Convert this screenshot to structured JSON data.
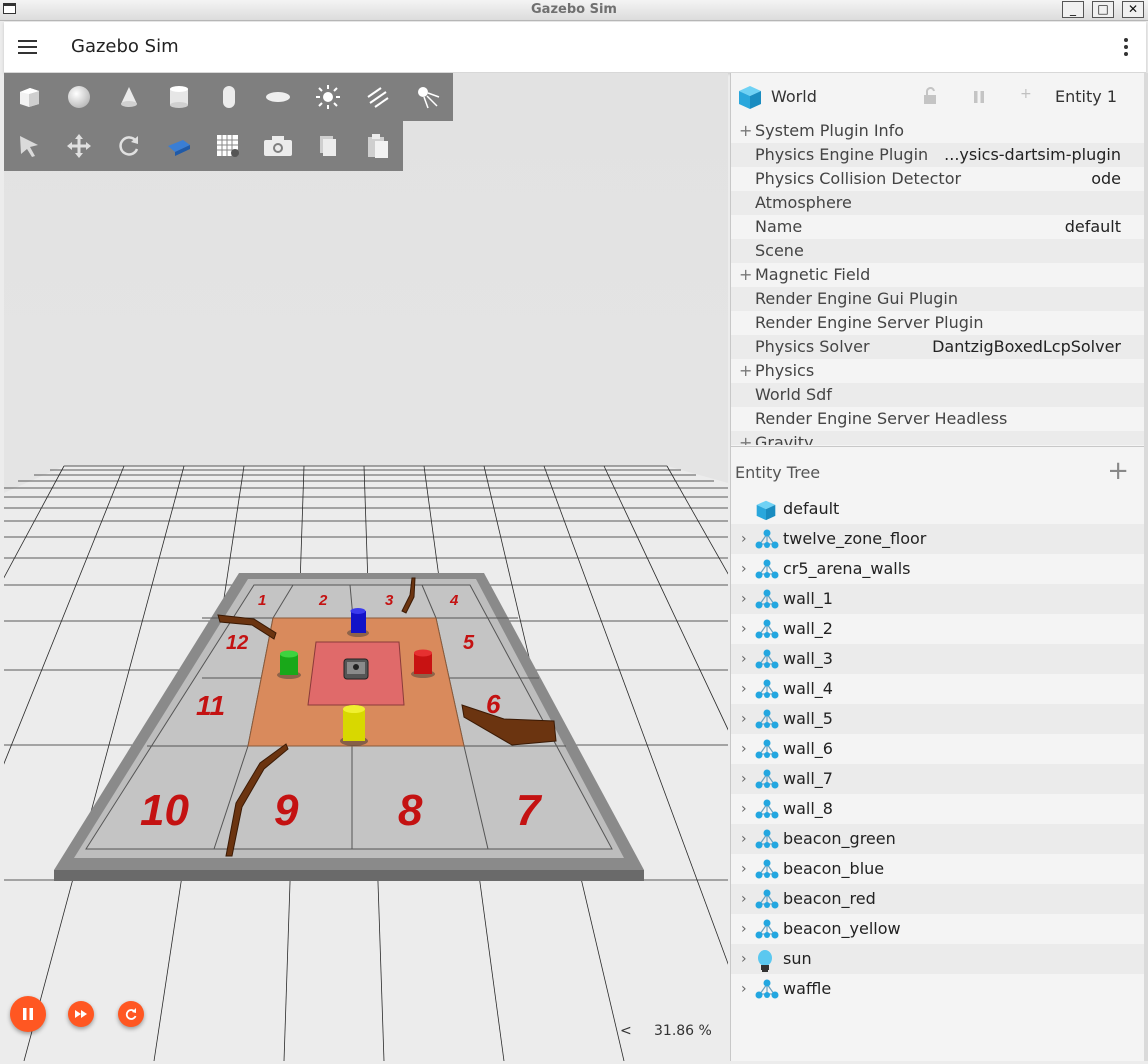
{
  "window": {
    "title": "Gazebo Sim",
    "buttons": [
      "_",
      "□",
      "✕"
    ]
  },
  "appbar": {
    "title": "Gazebo Sim"
  },
  "toolbar": {
    "shapes": [
      "box-icon",
      "sphere-icon",
      "cone-icon",
      "cylinder-icon",
      "capsule-icon",
      "ellipsoid-icon",
      "point-light-icon",
      "directional-light-icon",
      "spot-light-icon"
    ],
    "transform": [
      "select-arrow-icon",
      "translate-icon",
      "rotate-icon",
      "view-angle-icon",
      "grid-icon",
      "screenshot-camera-icon",
      "copy-icon",
      "paste-icon"
    ]
  },
  "scene": {
    "zone_labels": [
      "1",
      "2",
      "3",
      "4",
      "5",
      "6",
      "7",
      "8",
      "9",
      "10",
      "11",
      "12"
    ],
    "colors": {
      "zone_text": "#c41212",
      "floor_orange": "#d98a5c",
      "center_red": "#e06a6a",
      "wall": "#808080",
      "brown_wall": "#6b3410",
      "beacon_green": "#19a819",
      "beacon_blue": "#1212c8",
      "beacon_red": "#c81212",
      "beacon_yellow": "#d8d800"
    }
  },
  "playback": {
    "pause_icon": "pause-icon",
    "step_icon": "fast-forward-icon",
    "reset_icon": "reset-icon",
    "accent": "#ff5722"
  },
  "rtf": {
    "arrow": "<",
    "value": "31.86 %"
  },
  "component_inspector": {
    "world_label": "World",
    "entity_label": "Entity 1",
    "properties": [
      {
        "expand": "+",
        "key": "System Plugin Info",
        "value": ""
      },
      {
        "expand": "",
        "key": "Physics Engine Plugin",
        "value": "...ysics-dartsim-plugin"
      },
      {
        "expand": "",
        "key": "Physics Collision Detector",
        "value": "ode"
      },
      {
        "expand": "",
        "key": "Atmosphere",
        "value": ""
      },
      {
        "expand": "",
        "key": "Name",
        "value": "default"
      },
      {
        "expand": "",
        "key": "Scene",
        "value": ""
      },
      {
        "expand": "+",
        "key": "Magnetic Field",
        "value": ""
      },
      {
        "expand": "",
        "key": "Render Engine Gui Plugin",
        "value": ""
      },
      {
        "expand": "",
        "key": "Render Engine Server Plugin",
        "value": ""
      },
      {
        "expand": "",
        "key": "Physics Solver",
        "value": "DantzigBoxedLcpSolver"
      },
      {
        "expand": "+",
        "key": "Physics",
        "value": ""
      },
      {
        "expand": "",
        "key": "World Sdf",
        "value": ""
      },
      {
        "expand": "",
        "key": "Render Engine Server Headless",
        "value": ""
      },
      {
        "expand": "+",
        "key": "Gravity",
        "value": ""
      }
    ]
  },
  "entity_tree": {
    "title": "Entity Tree",
    "add": "+",
    "items": [
      {
        "label": "default",
        "chevron": "",
        "icon": "world-cube-icon"
      },
      {
        "label": "twelve_zone_floor",
        "chevron": "›",
        "icon": "model-icon"
      },
      {
        "label": "cr5_arena_walls",
        "chevron": "›",
        "icon": "model-icon"
      },
      {
        "label": "wall_1",
        "chevron": "›",
        "icon": "model-icon"
      },
      {
        "label": "wall_2",
        "chevron": "›",
        "icon": "model-icon"
      },
      {
        "label": "wall_3",
        "chevron": "›",
        "icon": "model-icon"
      },
      {
        "label": "wall_4",
        "chevron": "›",
        "icon": "model-icon"
      },
      {
        "label": "wall_5",
        "chevron": "›",
        "icon": "model-icon"
      },
      {
        "label": "wall_6",
        "chevron": "›",
        "icon": "model-icon"
      },
      {
        "label": "wall_7",
        "chevron": "›",
        "icon": "model-icon"
      },
      {
        "label": "wall_8",
        "chevron": "›",
        "icon": "model-icon"
      },
      {
        "label": "beacon_green",
        "chevron": "›",
        "icon": "model-icon"
      },
      {
        "label": "beacon_blue",
        "chevron": "›",
        "icon": "model-icon"
      },
      {
        "label": "beacon_red",
        "chevron": "›",
        "icon": "model-icon"
      },
      {
        "label": "beacon_yellow",
        "chevron": "›",
        "icon": "model-icon"
      },
      {
        "label": "sun",
        "chevron": "›",
        "icon": "light-bulb-icon"
      },
      {
        "label": "waffle",
        "chevron": "›",
        "icon": "model-icon"
      }
    ]
  }
}
